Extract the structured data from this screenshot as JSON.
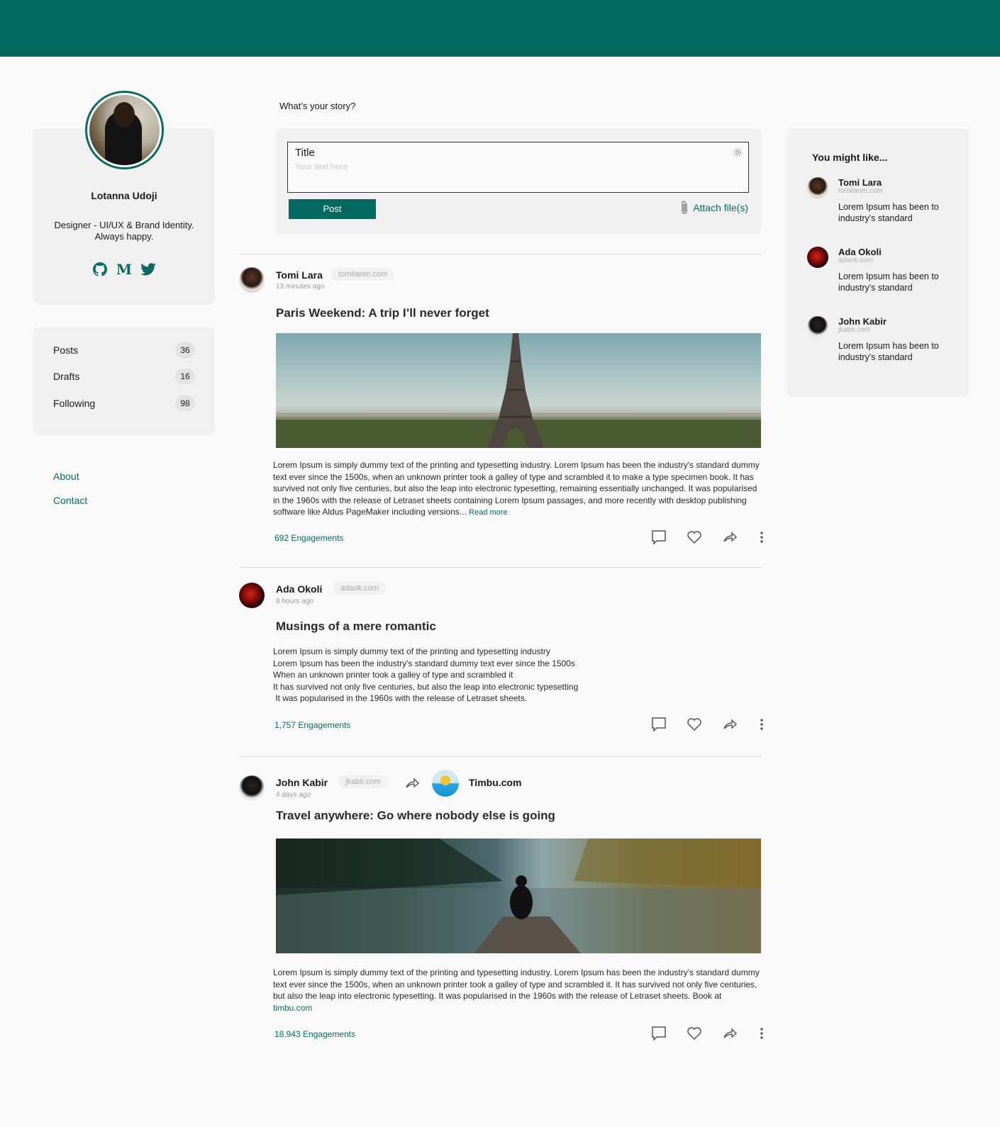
{
  "profile": {
    "name": "Lotanna Udoji",
    "bio_line1": "Designer - UI/UX & Brand Identity.",
    "bio_line2": "Always happy.",
    "social": [
      "github-icon",
      "medium-icon",
      "twitter-icon"
    ]
  },
  "stats": [
    {
      "label": "Posts",
      "count": "36"
    },
    {
      "label": "Drafts",
      "count": "16"
    },
    {
      "label": "Following",
      "count": "98"
    }
  ],
  "links": {
    "about": "About",
    "contact": "Contact"
  },
  "composer": {
    "prompt": "What’s your story?",
    "title_label": "Title",
    "placeholder": "Your text here",
    "post_label": "Post",
    "attach_label": "Attach file(s)"
  },
  "posts": [
    {
      "author": "Tomi Lara",
      "site": "tomilaren.com",
      "time": "13 minutes ago",
      "title": "Paris Weekend: A trip I’ll never forget",
      "body": "Lorem Ipsum is simply dummy text of the printing and typesetting industry. Lorem Ipsum has been the industry's standard dummy text ever since the 1500s, when an unknown printer took a galley of type and scrambled it to make a type specimen book. It has survived not only five centuries, but also the leap into electronic typesetting, remaining essentially unchanged. It was popularised in the 1960s with the release of Letraset sheets containing Lorem Ipsum passages, and more recently with desktop publishing software like Aldus PageMaker including versions...",
      "read_more": "Read more",
      "engagements": "692 Engagements"
    },
    {
      "author": "Ada Okoli",
      "site": "adaok.com",
      "time": "8 hours ago",
      "title": "Musings of a mere romantic",
      "lines": [
        "Lorem Ipsum is simply dummy text of the printing and typesetting industry",
        "Lorem Ipsum has been the industry's standard dummy text ever since the 1500s",
        "When an unknown printer took a galley of type and scrambled it",
        "It has survived not only five centuries, but also the leap into electronic typesetting",
        " It was popularised in the 1960s with the release of Letraset sheets."
      ],
      "engagements": "1,757 Engagements"
    },
    {
      "author": "John Kabir",
      "site": "jkabir.com",
      "time": "4 days ago",
      "shared_from": "Timbu.com",
      "title": "Travel anywhere: Go where nobody else is going",
      "body": "Lorem Ipsum is simply dummy text of the printing and typesetting industry. Lorem Ipsum has been the industry's standard dummy text ever since the 1500s, when an unknown printer took a galley of type and scrambled it. It has survived not only five centuries, but also the leap into electronic typesetting. It was popularised in the 1960s with the release of Letraset sheets. Book at",
      "link": "timbu.com",
      "engagements": "18,943 Engagements"
    }
  ],
  "suggestions": {
    "heading": "You might like...",
    "items": [
      {
        "name": "Tomi Lara",
        "domain": "tomilaren.com",
        "text": "Lorem Ipsum has been to industry's standard"
      },
      {
        "name": "Ada Okoli",
        "domain": "adaok.com",
        "text": "Lorem Ipsum has been to industry's standard"
      },
      {
        "name": "John Kabir",
        "domain": "jkabir.com",
        "text": "Lorem Ipsum has been to industry's standard"
      }
    ]
  },
  "colors": {
    "brand": "#056962",
    "accent": "#0b6a62"
  }
}
